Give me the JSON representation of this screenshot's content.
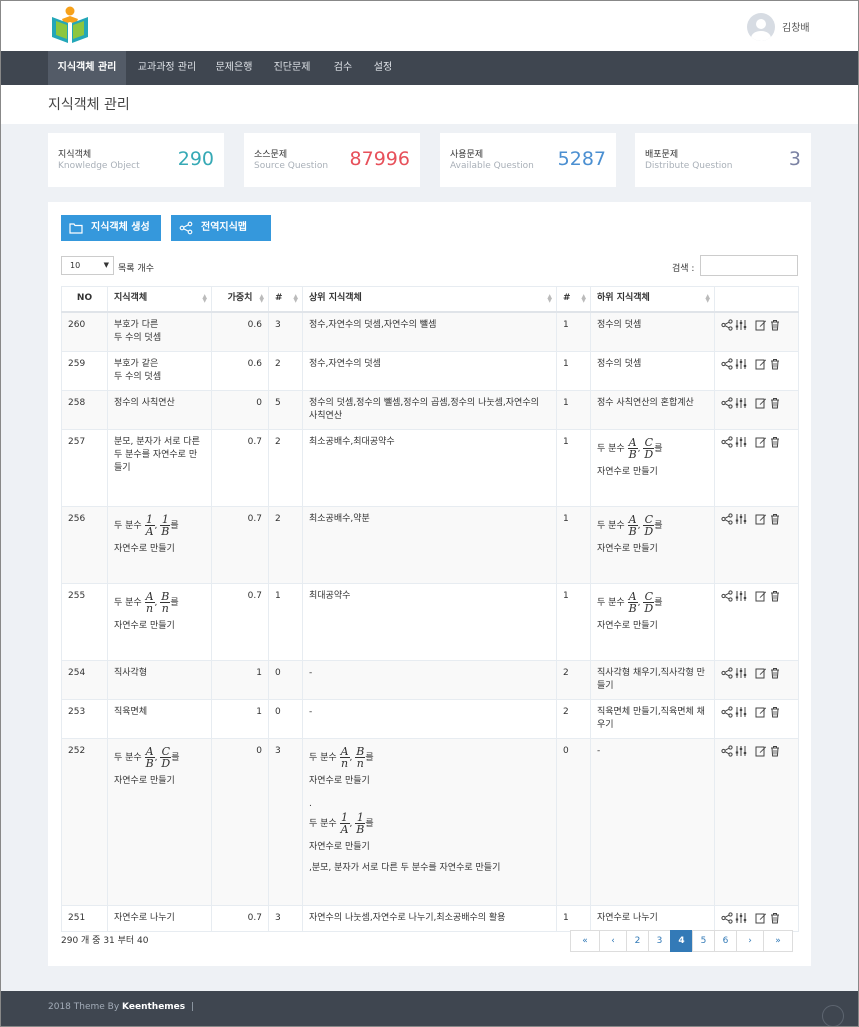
{
  "header": {
    "user_name": "김창배"
  },
  "nav": {
    "items": [
      "지식객체 관리",
      "교과과정 관리",
      "문제은행",
      "진단문제",
      "검수",
      "설정"
    ],
    "active": 0
  },
  "page_title": "지식객체 관리",
  "stats": [
    {
      "title": "지식객체",
      "subtitle": "Knowledge Object",
      "value": "290",
      "color": "#36a9b5"
    },
    {
      "title": "소스문제",
      "subtitle": "Source Question",
      "value": "87996",
      "color": "#e7505a"
    },
    {
      "title": "사용문제",
      "subtitle": "Available Question",
      "value": "5287",
      "color": "#4b8fd1"
    },
    {
      "title": "배포문제",
      "subtitle": "Distribute Question",
      "value": "3",
      "color": "#7b82a3"
    }
  ],
  "buttons": {
    "create": "지식객체 생성",
    "map": "전역지식맵"
  },
  "table_controls": {
    "page_length": "10",
    "page_length_label": "목록 개수",
    "search_label": "검색 :"
  },
  "table": {
    "headers": [
      "NO",
      "지식객체",
      "가중치",
      "#",
      "상위 지식객체",
      "#",
      "하위 지식객체",
      ""
    ],
    "rows": [
      {
        "no": "260",
        "name": "부호가 다른\n두 수의 덧셈",
        "weight": "0.6",
        "pcount": "3",
        "parents": "정수,자연수의 덧셈,자연수의 뺄셈",
        "ccount": "1",
        "children": "정수의 덧셈"
      },
      {
        "no": "259",
        "name": "부호가 같은\n두 수의 덧셈",
        "weight": "0.6",
        "pcount": "2",
        "parents": "정수,자연수의 덧셈",
        "ccount": "1",
        "children": "정수의 덧셈"
      },
      {
        "no": "258",
        "name": "정수의 사칙연산",
        "weight": "0",
        "pcount": "5",
        "parents": "정수의 덧셈,정수의 뺄셈,정수의 곱셈,정수의 나눗셈,자연수의 사칙연산",
        "ccount": "1",
        "children": "정수 사칙연산의 혼합계산"
      },
      {
        "no": "257",
        "name": "분모, 분자가 서로 다른 두 분수를 자연수로 만들기",
        "weight": "0.7",
        "pcount": "2",
        "parents": "최소공배수,최대공약수",
        "ccount": "1",
        "children": "자연수로 만들기"
      },
      {
        "no": "256",
        "name": "자연수로 만들기",
        "weight": "0.7",
        "pcount": "2",
        "parents": "최소공배수,약분",
        "ccount": "1",
        "children": "자연수로 만들기"
      },
      {
        "no": "255",
        "name": "자연수로 만들기",
        "weight": "0.7",
        "pcount": "1",
        "parents": "최대공약수",
        "ccount": "1",
        "children": "자연수로 만들기"
      },
      {
        "no": "254",
        "name": "직사각형",
        "weight": "1",
        "pcount": "0",
        "parents": "-",
        "ccount": "2",
        "children": "직사각형 채우기,직사각형 만들기"
      },
      {
        "no": "253",
        "name": "직육면체",
        "weight": "1",
        "pcount": "0",
        "parents": "-",
        "ccount": "2",
        "children": "직육면체 만들기,직육면체 채우기"
      },
      {
        "no": "252",
        "name": "자연수로 만들기",
        "weight": "0",
        "pcount": "3",
        "parents": "자연수로 만들기",
        "parents2": "자연수로 만들기",
        "parents3": ",분모, 분자가 서로 다른 두 분수를 자연수로 만들기",
        "ccount": "0",
        "children": "-"
      },
      {
        "no": "251",
        "name": "자연수로 나누기",
        "weight": "0.7",
        "pcount": "3",
        "parents": "자연수의 나눗셈,자연수로 나누기,최소공배수의 활용",
        "ccount": "1",
        "children": "자연수로 나누기"
      }
    ]
  },
  "math": {
    "lead": "두 분수",
    "suffix": "를",
    "comma": ",",
    "dot": ".",
    "A": "A",
    "B": "B",
    "C": "C",
    "D": "D",
    "n": "n",
    "one": "1"
  },
  "pagination": {
    "info": "290 개 중 31 부터 40",
    "items": [
      "«",
      "‹",
      "2",
      "3",
      "4",
      "5",
      "6",
      "›",
      "»"
    ],
    "active": "4"
  },
  "footer": {
    "text": "2018 Theme By",
    "brand": "Keenthemes",
    "sep": "|"
  }
}
